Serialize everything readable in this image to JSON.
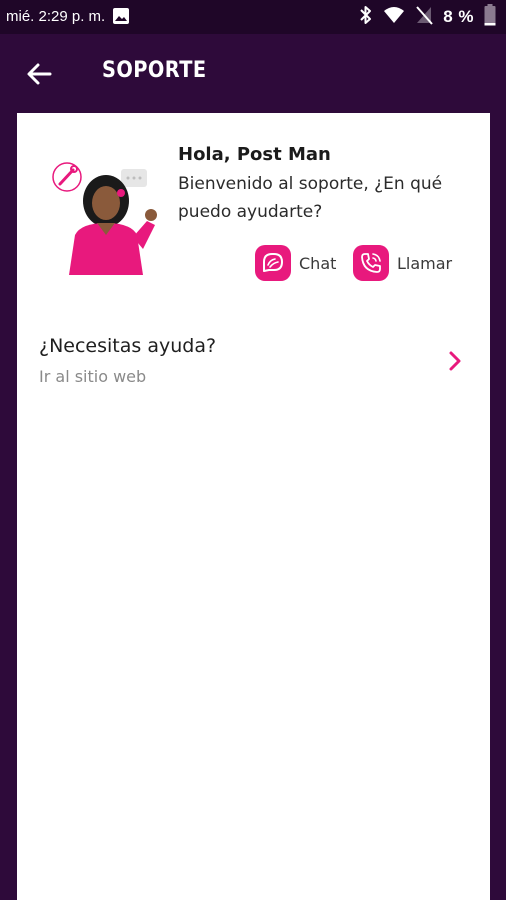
{
  "status_bar": {
    "time": "mié. 2:29 p. m.",
    "battery_text": "8 %",
    "icons": [
      "gallery-icon",
      "bluetooth-icon",
      "wifi-icon",
      "no-signal-icon",
      "battery-icon"
    ]
  },
  "app_bar": {
    "title": "SOPORTE",
    "back_icon": "arrow-left-icon"
  },
  "support": {
    "greeting": "Hola, Post Man",
    "welcome": "Bienvenido al soporte, ¿En qué puedo ayudarte?",
    "chat_label": "Chat",
    "call_label": "Llamar",
    "chat_icon": "chat-bubble-icon",
    "call_icon": "phone-icon"
  },
  "help": {
    "title": "¿Necesitas ayuda?",
    "subtitle": "Ir al sitio web",
    "chevron_icon": "chevron-right-icon"
  },
  "colors": {
    "app_background": "#2e0a3a",
    "accent": "#e8197d",
    "card": "#ffffff"
  }
}
